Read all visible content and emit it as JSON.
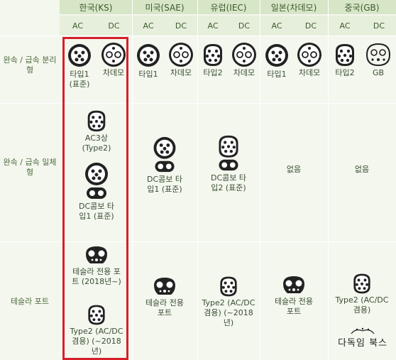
{
  "regions": [
    {
      "name": "한국(KS)"
    },
    {
      "name": "미국(SAE)"
    },
    {
      "name": "유럽(IEC)"
    },
    {
      "name": "일본(차데모)"
    },
    {
      "name": "중국(GB)"
    }
  ],
  "ac_label": "AC",
  "dc_label": "DC",
  "rows": {
    "slow_fast_separate": {
      "label": "완속 / 급속 분리형"
    },
    "slow_fast_integrated": {
      "label": "완속 / 급속 일체형"
    },
    "tesla": {
      "label": "테슬라 포트"
    }
  },
  "sep_cells": [
    {
      "label": "타입1 (표준)",
      "icon": "type1-plug-icon"
    },
    {
      "label": "차데모",
      "icon": "chademo-plug-icon"
    },
    {
      "label": "타입1",
      "icon": "type1-plug-icon"
    },
    {
      "label": "차데모",
      "icon": "chademo-plug-icon"
    },
    {
      "label": "타입2",
      "icon": "type2-plug-icon"
    },
    {
      "label": "차데모",
      "icon": "chademo-plug-icon"
    },
    {
      "label": "타입1",
      "icon": "type1-plug-icon"
    },
    {
      "label": "차데모",
      "icon": "chademo-plug-icon"
    },
    {
      "label": "타입2",
      "icon": "type2-plug-icon"
    },
    {
      "label": "GB",
      "icon": "gb-plug-icon"
    }
  ],
  "int_cells": {
    "ks_ac3": "AC3상 (Type2)",
    "ks_combo": "DC콤보 타입1 (표준)",
    "sae_combo": "DC콤보 타입1 (표준)",
    "iec_combo": "DC콤보 타입2 (표준)",
    "jp": "없음",
    "cn": "없음"
  },
  "tesla_cells": {
    "ks_tesla": "테슬라 전용 포트 (2018년~)",
    "ks_type2": "Type2 (AC/DC 겸용) (~2018년)",
    "sae": "테슬라 전용 포트",
    "iec": "Type2 (AC/DC 겸용) (~2018년)",
    "jp": "테슬라 전용 포트",
    "cn": "Type2 (AC/DC 겸용)"
  },
  "brand": "다독임 북스",
  "colors": {
    "highlight": "#d61f2b",
    "header_bg": "#d7e6c6",
    "body_bg": "#f4f7ee"
  }
}
